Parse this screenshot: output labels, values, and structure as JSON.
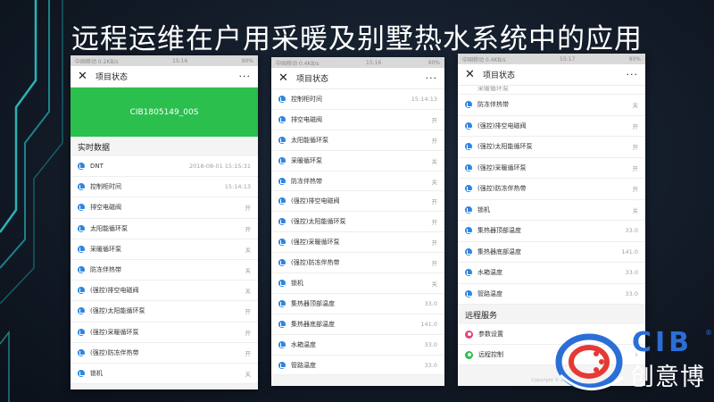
{
  "slide": {
    "title": "远程运维在户用采暖及别墅热水系统中的应用"
  },
  "colors": {
    "banner_green": "#2bbf4d",
    "row_icon_blue": "#2f86e0",
    "brand_blue": "#2b6fd6",
    "settings_icon": "#e0457b",
    "remote_control_icon": "#2bbf4d"
  },
  "phone1": {
    "status": {
      "left": "中国移动 0.2KB/s",
      "time": "15:16",
      "right": "90%"
    },
    "nav": {
      "close": "✕",
      "title": "项目状态",
      "more": "···"
    },
    "banner_text": "CIB1805149_00S",
    "section_title": "实时数据",
    "rows": [
      {
        "label": "DNT",
        "value": "2018-08-01 15:15:31"
      },
      {
        "label": "控制柜时间",
        "value": "15:14:13"
      },
      {
        "label": "排空电磁阀",
        "value": "开"
      },
      {
        "label": "太阳能循环泵",
        "value": "开"
      },
      {
        "label": "采暖循环泵",
        "value": "关"
      },
      {
        "label": "防冻伴热带",
        "value": "关"
      },
      {
        "label": "(强控)排空电磁阀",
        "value": "关"
      },
      {
        "label": "(强控)太阳能循环泵",
        "value": "开"
      },
      {
        "label": "(强控)采暖循环泵",
        "value": "开"
      },
      {
        "label": "(强控)防冻伴热带",
        "value": "开"
      },
      {
        "label": "锁机",
        "value": "关"
      }
    ]
  },
  "phone2": {
    "status": {
      "left": "中国移动 0.4KB/s",
      "time": "15:16",
      "right": "90%"
    },
    "nav": {
      "close": "✕",
      "title": "项目状态",
      "more": "···"
    },
    "rows": [
      {
        "label": "控制柜时间",
        "value": "15:14:13"
      },
      {
        "label": "排空电磁阀",
        "value": "开"
      },
      {
        "label": "太阳能循环泵",
        "value": "开"
      },
      {
        "label": "采暖循环泵",
        "value": "关"
      },
      {
        "label": "防冻伴热带",
        "value": "关"
      },
      {
        "label": "(强控)排空电磁阀",
        "value": "开"
      },
      {
        "label": "(强控)太阳能循环泵",
        "value": "开"
      },
      {
        "label": "(强控)采暖循环泵",
        "value": "开"
      },
      {
        "label": "(强控)防冻伴热带",
        "value": "开"
      },
      {
        "label": "锁机",
        "value": "关"
      },
      {
        "label": "集热器顶部温度",
        "value": "33.0"
      },
      {
        "label": "集热器底部温度",
        "value": "141.0"
      },
      {
        "label": "水箱温度",
        "value": "33.0"
      },
      {
        "label": "管路温度",
        "value": "33.0"
      }
    ]
  },
  "phone3": {
    "status": {
      "left": "中国移动 0.4KB/s",
      "time": "15:17",
      "right": "90%"
    },
    "nav": {
      "close": "✕",
      "title": "项目状态",
      "more": "···"
    },
    "partial_row": "采暖循环泵",
    "rows": [
      {
        "label": "防冻伴热带",
        "value": "关"
      },
      {
        "label": "(强控)排空电磁阀",
        "value": "开"
      },
      {
        "label": "(强控)太阳能循环泵",
        "value": "开"
      },
      {
        "label": "(强控)采暖循环泵",
        "value": "开"
      },
      {
        "label": "(强控)防冻伴热带",
        "value": "开"
      },
      {
        "label": "锁机",
        "value": "关"
      },
      {
        "label": "集热器顶部温度",
        "value": "33.0"
      },
      {
        "label": "集热器底部温度",
        "value": "141.0"
      },
      {
        "label": "水箱温度",
        "value": "33.0"
      },
      {
        "label": "管路温度",
        "value": "33.0"
      }
    ],
    "service_section_title": "远程服务",
    "services": [
      {
        "label": "参数设置",
        "icon": "gear-icon",
        "chevron": "›"
      },
      {
        "label": "远程控制",
        "icon": "remote-control-icon",
        "chevron": "›"
      }
    ],
    "copyright": "Copyright © 2018"
  },
  "logo": {
    "text": "CIB",
    "subtitle": "创意博",
    "registered": "®"
  }
}
